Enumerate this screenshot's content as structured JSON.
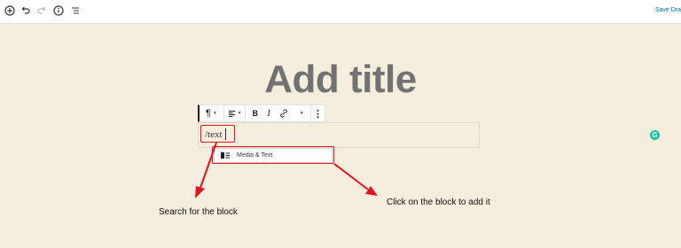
{
  "topbar": {
    "icons": [
      "add-block-icon",
      "undo-icon",
      "redo-icon",
      "info-icon",
      "outline-icon"
    ],
    "save_label": "Save Dra"
  },
  "editor": {
    "title_placeholder": "Add title",
    "toolbar": {
      "paragraph": "¶",
      "align": "align-left-icon",
      "bold": "B",
      "italic": "I",
      "link": "link-icon",
      "more": "⋮"
    },
    "block_text": "/text",
    "suggestion": {
      "icon": "media-text-icon",
      "label": "Media & Text"
    }
  },
  "annotations": {
    "search": "Search for the block",
    "click": "Click on the block to add it"
  },
  "colors": {
    "highlight": "#e0141e",
    "grammarly": "#15c39a",
    "background": "#f5eddd"
  }
}
